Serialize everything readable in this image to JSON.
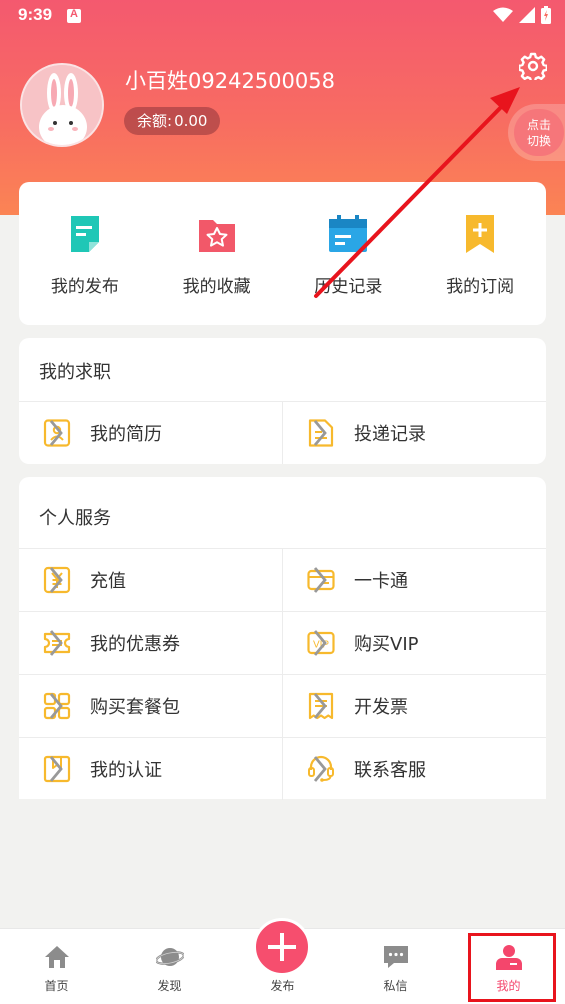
{
  "status_bar": {
    "time": "9:39"
  },
  "profile": {
    "username": "小百姓09242500058",
    "balance_label": "余额:",
    "balance_value": "0.00",
    "switch_label_line1": "点击",
    "switch_label_line2": "切换"
  },
  "quick_actions": [
    {
      "label": "我的发布",
      "icon": "doc-icon",
      "color": "#1fc7b6"
    },
    {
      "label": "我的收藏",
      "icon": "star-folder-icon",
      "color": "#f25869"
    },
    {
      "label": "历史记录",
      "icon": "calendar-icon",
      "color": "#2aa6e6"
    },
    {
      "label": "我的订阅",
      "icon": "bookmark-plus-icon",
      "color": "#f7b92d"
    }
  ],
  "job_section": {
    "title": "我的求职",
    "items": [
      {
        "label": "我的简历",
        "icon": "resume-icon"
      },
      {
        "label": "投递记录",
        "icon": "delivery-record-icon"
      }
    ]
  },
  "service_section": {
    "title": "个人服务",
    "items": [
      {
        "label": "充值",
        "icon": "recharge-icon"
      },
      {
        "label": "一卡通",
        "icon": "card-icon"
      },
      {
        "label": "我的优惠券",
        "icon": "coupon-icon"
      },
      {
        "label": "购买VIP",
        "icon": "vip-icon"
      },
      {
        "label": "购买套餐包",
        "icon": "package-icon"
      },
      {
        "label": "开发票",
        "icon": "invoice-icon"
      },
      {
        "label": "我的认证",
        "icon": "certification-icon"
      },
      {
        "label": "联系客服",
        "icon": "customer-service-icon"
      }
    ]
  },
  "tabbar": [
    {
      "label": "首页",
      "icon": "home-icon"
    },
    {
      "label": "发现",
      "icon": "planet-icon"
    },
    {
      "label": "发布",
      "icon": "plus-icon"
    },
    {
      "label": "私信",
      "icon": "message-icon"
    },
    {
      "label": "我的",
      "icon": "user-icon",
      "active": true
    }
  ],
  "colors": {
    "accent": "#f4466c",
    "icon_yellow": "#f7b92d",
    "annotation_red": "#e8141d"
  }
}
